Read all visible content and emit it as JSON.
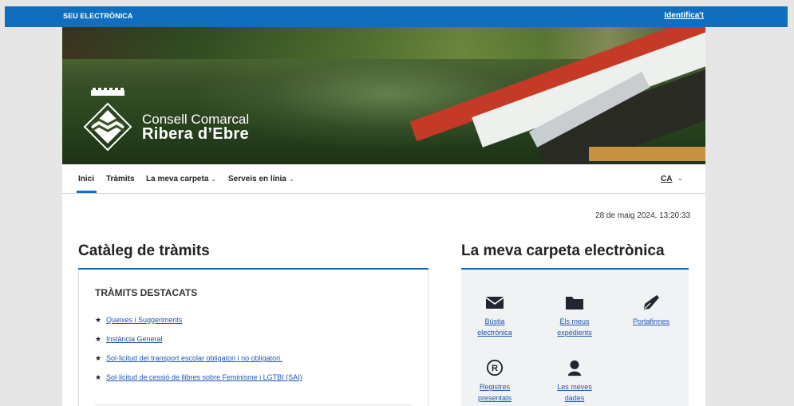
{
  "topbar": {
    "seu_label": "SEU ELECTRÒNICA",
    "identify_label": "Identifica't"
  },
  "brand": {
    "line1": "Consell Comarcal",
    "line2": "Ribera d’Ebre"
  },
  "nav": {
    "items": [
      {
        "label": "Inici"
      },
      {
        "label": "Tràmits"
      },
      {
        "label": "La meva carpeta"
      },
      {
        "label": "Serveis en línia"
      }
    ],
    "language": "CA"
  },
  "datetime": "28 de maig 2024, 13:20:33",
  "catalog": {
    "title": "Catàleg de tràmits",
    "featured_title": "TRÀMITS DESTACATS",
    "items": [
      "Queixes i Suggeriments",
      "Instància General",
      "Sol·licitud del transport escolar obligatori i no obligatori.",
      "Sol·licitud de cessió de llibres sobre Feminisme i LGTBI (SAI)"
    ]
  },
  "folder": {
    "title": "La meva carpeta electrònica",
    "tiles": [
      {
        "l1": "Bústia",
        "l2": "electrònica",
        "icon": "envelope-icon"
      },
      {
        "l1": "Els meus",
        "l2": "expedients",
        "icon": "folder-icon"
      },
      {
        "l1": "Portafirmes",
        "l2": "",
        "icon": "pen-nib-icon"
      },
      {
        "l1": "Registres",
        "l2": "presentats",
        "icon": "registered-icon"
      },
      {
        "l1": "Les meves",
        "l2": "dades",
        "icon": "user-icon"
      }
    ]
  },
  "colors": {
    "accent": "#0f6ebd",
    "link": "#1d56b3",
    "panel": "#f1f2f4"
  }
}
